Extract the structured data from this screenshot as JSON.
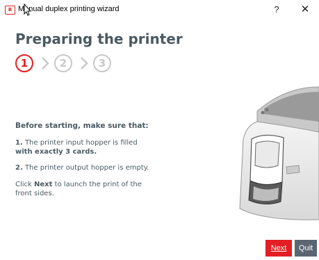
{
  "window": {
    "title": "Manual duplex printing wizard",
    "help_label": "?",
    "close_label": "✕",
    "app_icon_label": "B"
  },
  "page": {
    "heading": "Preparing the printer",
    "steps": [
      "1",
      "2",
      "3"
    ],
    "active_step": 1
  },
  "instructions": {
    "intro": "Before starting, make sure that:",
    "item1_num": "1.",
    "item1_text": " The printer input hopper is filled ",
    "item1_bold": "with exactly 3 cards.",
    "item2_num": "2.",
    "item2_text": " The printer output hopper is empty.",
    "click_prefix": "Click ",
    "click_bold": "Next",
    "click_suffix": " to launch the print of the front sides."
  },
  "buttons": {
    "next_label": "Next",
    "quit_label": "Quit"
  },
  "colors": {
    "accent": "#e31e24",
    "heading": "#4a5a63",
    "inactive_step": "#c8c8c8",
    "quit_bg": "#5a6770"
  }
}
